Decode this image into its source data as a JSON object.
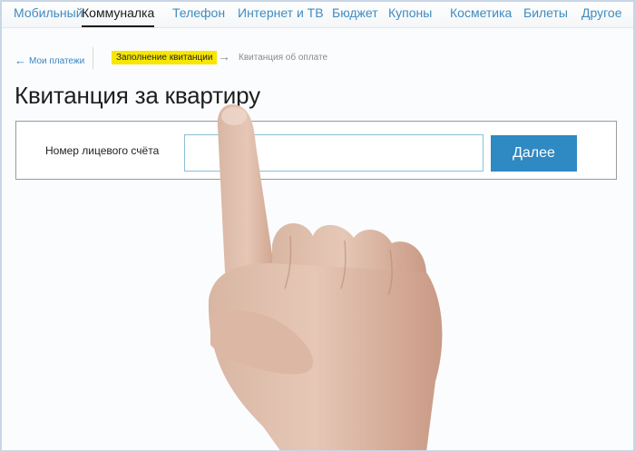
{
  "top_nav": {
    "items": [
      {
        "label": "Мобильный",
        "active": false
      },
      {
        "label": "Коммуналка",
        "active": true
      },
      {
        "label": "Телефон",
        "active": false
      },
      {
        "label": "Интернет и ТВ",
        "active": false
      },
      {
        "label": "Бюджет",
        "active": false
      },
      {
        "label": "Купоны",
        "active": false
      },
      {
        "label": "Косметика",
        "active": false
      },
      {
        "label": "Билеты",
        "active": false
      },
      {
        "label": "Другое",
        "active": false
      }
    ]
  },
  "breadcrumb": {
    "back_label": "Мои платежи",
    "current_step": "Заполнение квитанции",
    "next_step": "Квитанция об оплате"
  },
  "page": {
    "title": "Квитанция за квартиру"
  },
  "form": {
    "account_label": "Номер лицевого счёта",
    "account_value": "",
    "submit_label": "Далее"
  },
  "colors": {
    "link": "#3f8cc0",
    "highlight": "#f7e600",
    "button": "#2f89c3"
  },
  "icons": {
    "back": "arrow-left-icon",
    "step": "arrow-right-icon"
  }
}
